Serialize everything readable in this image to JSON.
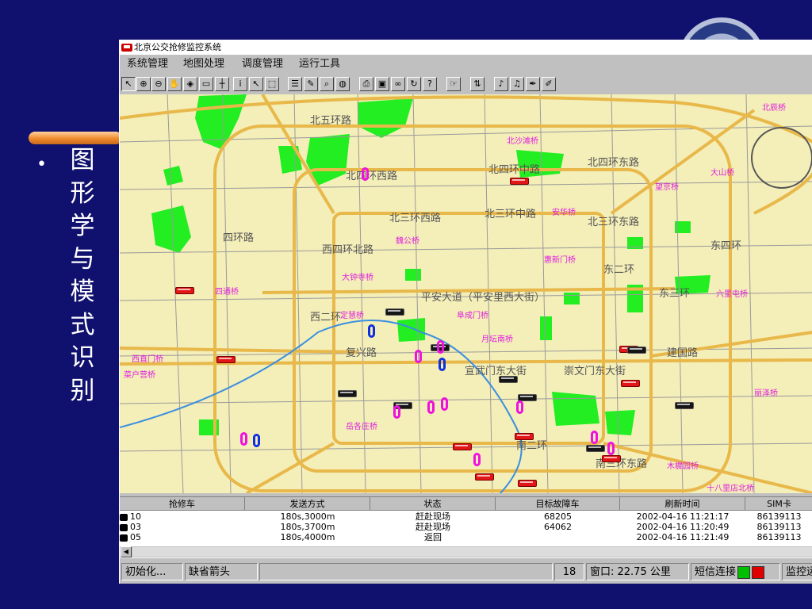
{
  "slide": {
    "bullet": "•",
    "title_chars": [
      "图",
      "形",
      "学",
      "与",
      "模",
      "式",
      "识",
      "别"
    ]
  },
  "window": {
    "title": "北京公交抢修监控系统",
    "menus": [
      "系统管理",
      "地图处理",
      "调度管理",
      "运行工具"
    ]
  },
  "toolbar_icons": [
    "arrow-icon",
    "zoom-in-icon",
    "zoom-out-icon",
    "pan-hand-icon",
    "center-icon",
    "ruler-icon",
    "crosshair-icon",
    "info-icon",
    "select-icon",
    "select-region-icon",
    "layers-icon",
    "draw-icon",
    "find-icon",
    "globe-icon",
    "print-icon",
    "save-icon",
    "binoculars-icon",
    "refresh-icon",
    "help-icon",
    "hand-point-icon",
    "sort-icon",
    "sound-icon",
    "bell-icon",
    "pen-icon",
    "edit-icon"
  ],
  "map": {
    "road_labels": [
      "北五环路",
      "北四环西路",
      "北四环中路",
      "北四环东路",
      "北三环西路",
      "北三环中路",
      "北三环东路",
      "平安大道（平安里西大街）",
      "复兴路",
      "宣武门东大街",
      "崇文门东大街",
      "建国路",
      "西四环北路",
      "西二环",
      "东二环",
      "东三环",
      "东四环",
      "南二环",
      "南三环东路",
      "四环路"
    ],
    "bridge_labels": [
      "北辰桥",
      "北沙滩桥",
      "望京桥",
      "大山桥",
      "四通桥",
      "安华桥",
      "魏公桥",
      "惠新门桥",
      "大钟寺桥",
      "六里屯桥",
      "定慧桥",
      "阜成门桥",
      "月坛南桥",
      "菜户营桥",
      "木樨园桥",
      "十八里店北桥",
      "丽泽桥",
      "岳各庄桥",
      "西直门桥"
    ]
  },
  "table": {
    "columns": [
      "抢修车",
      "发送方式",
      "状态",
      "目标故障车",
      "刷新时间",
      "SIM卡"
    ],
    "rows": [
      {
        "car": "10",
        "send": "180s,3000m",
        "status": "赶赴现场",
        "target": "68205",
        "time": "2002-04-16 11:21:17",
        "sim": "86139113"
      },
      {
        "car": "03",
        "send": "180s,3700m",
        "status": "赶赴现场",
        "target": "64062",
        "time": "2002-04-16 11:20:49",
        "sim": "86139113"
      },
      {
        "car": "05",
        "send": "180s,4000m",
        "status": "返回",
        "target": "",
        "time": "2002-04-16 11:21:49",
        "sim": "86139113"
      }
    ]
  },
  "statusbar": {
    "init": "初始化...",
    "cursor": "缺省箭头",
    "count": "18",
    "window_size": "窗口: 22.75 公里",
    "sms": "短信连接",
    "monitor": "监控运"
  },
  "colors": {
    "slide_bg": "#10106e",
    "map_bg": "#f4eeb8",
    "park_green": "#22ee22",
    "major_road": "#e8b84a",
    "led_green": "#00c000",
    "led_red": "#e00000"
  }
}
